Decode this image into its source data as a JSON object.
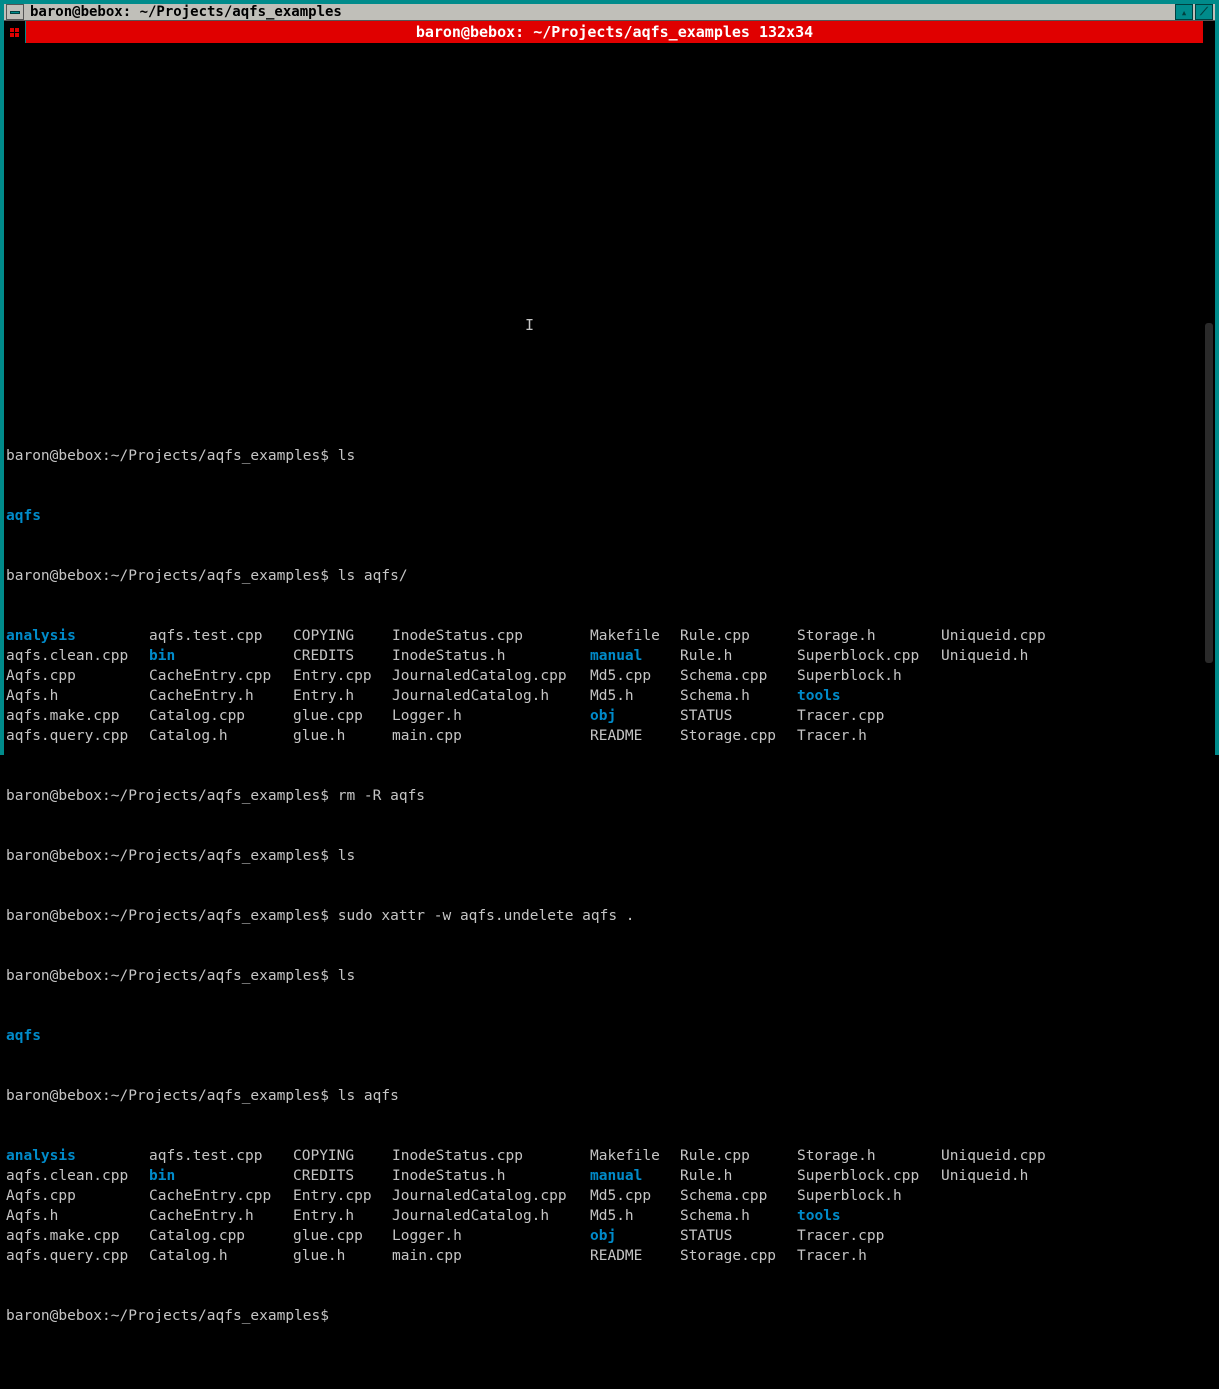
{
  "window": {
    "title": "baron@bebox: ~/Projects/aqfs_examples",
    "menubar": "baron@bebox: ~/Projects/aqfs_examples 132x34"
  },
  "prompts": {
    "p1": "baron@bebox:~/Projects/aqfs_examples$ ls",
    "p2": "baron@bebox:~/Projects/aqfs_examples$ ls aqfs/",
    "p3": "baron@bebox:~/Projects/aqfs_examples$ rm -R aqfs",
    "p4": "baron@bebox:~/Projects/aqfs_examples$ ls",
    "p5": "baron@bebox:~/Projects/aqfs_examples$ sudo xattr -w aqfs.undelete aqfs .",
    "p6": "baron@bebox:~/Projects/aqfs_examples$ ls",
    "p7": "baron@bebox:~/Projects/aqfs_examples$ ls aqfs",
    "p8": "baron@bebox:~/Projects/aqfs_examples$ "
  },
  "single": {
    "aqfs": "aqfs"
  },
  "listing": {
    "rows": [
      [
        {
          "t": "analysis",
          "k": "dir"
        },
        {
          "t": "aqfs.test.cpp",
          "k": "file"
        },
        {
          "t": "COPYING",
          "k": "file"
        },
        {
          "t": "InodeStatus.cpp",
          "k": "file"
        },
        {
          "t": "Makefile",
          "k": "file"
        },
        {
          "t": "Rule.cpp",
          "k": "file"
        },
        {
          "t": "Storage.h",
          "k": "file"
        },
        {
          "t": "Uniqueid.cpp",
          "k": "file"
        }
      ],
      [
        {
          "t": "aqfs.clean.cpp",
          "k": "file"
        },
        {
          "t": "bin",
          "k": "dir"
        },
        {
          "t": "CREDITS",
          "k": "file"
        },
        {
          "t": "InodeStatus.h",
          "k": "file"
        },
        {
          "t": "manual",
          "k": "dir"
        },
        {
          "t": "Rule.h",
          "k": "file"
        },
        {
          "t": "Superblock.cpp",
          "k": "file"
        },
        {
          "t": "Uniqueid.h",
          "k": "file"
        }
      ],
      [
        {
          "t": "Aqfs.cpp",
          "k": "file"
        },
        {
          "t": "CacheEntry.cpp",
          "k": "file"
        },
        {
          "t": "Entry.cpp",
          "k": "file"
        },
        {
          "t": "JournaledCatalog.cpp",
          "k": "file"
        },
        {
          "t": "Md5.cpp",
          "k": "file"
        },
        {
          "t": "Schema.cpp",
          "k": "file"
        },
        {
          "t": "Superblock.h",
          "k": "file"
        },
        {
          "t": "",
          "k": "file"
        }
      ],
      [
        {
          "t": "Aqfs.h",
          "k": "file"
        },
        {
          "t": "CacheEntry.h",
          "k": "file"
        },
        {
          "t": "Entry.h",
          "k": "file"
        },
        {
          "t": "JournaledCatalog.h",
          "k": "file"
        },
        {
          "t": "Md5.h",
          "k": "file"
        },
        {
          "t": "Schema.h",
          "k": "file"
        },
        {
          "t": "tools",
          "k": "dir"
        },
        {
          "t": "",
          "k": "file"
        }
      ],
      [
        {
          "t": "aqfs.make.cpp",
          "k": "file"
        },
        {
          "t": "Catalog.cpp",
          "k": "file"
        },
        {
          "t": "glue.cpp",
          "k": "file"
        },
        {
          "t": "Logger.h",
          "k": "file"
        },
        {
          "t": "obj",
          "k": "dir"
        },
        {
          "t": "STATUS",
          "k": "file"
        },
        {
          "t": "Tracer.cpp",
          "k": "file"
        },
        {
          "t": "",
          "k": "file"
        }
      ],
      [
        {
          "t": "aqfs.query.cpp",
          "k": "file"
        },
        {
          "t": "Catalog.h",
          "k": "file"
        },
        {
          "t": "glue.h",
          "k": "file"
        },
        {
          "t": "main.cpp",
          "k": "file"
        },
        {
          "t": "README",
          "k": "file"
        },
        {
          "t": "Storage.cpp",
          "k": "file"
        },
        {
          "t": "Tracer.h",
          "k": "file"
        },
        {
          "t": "",
          "k": "file"
        }
      ]
    ]
  }
}
